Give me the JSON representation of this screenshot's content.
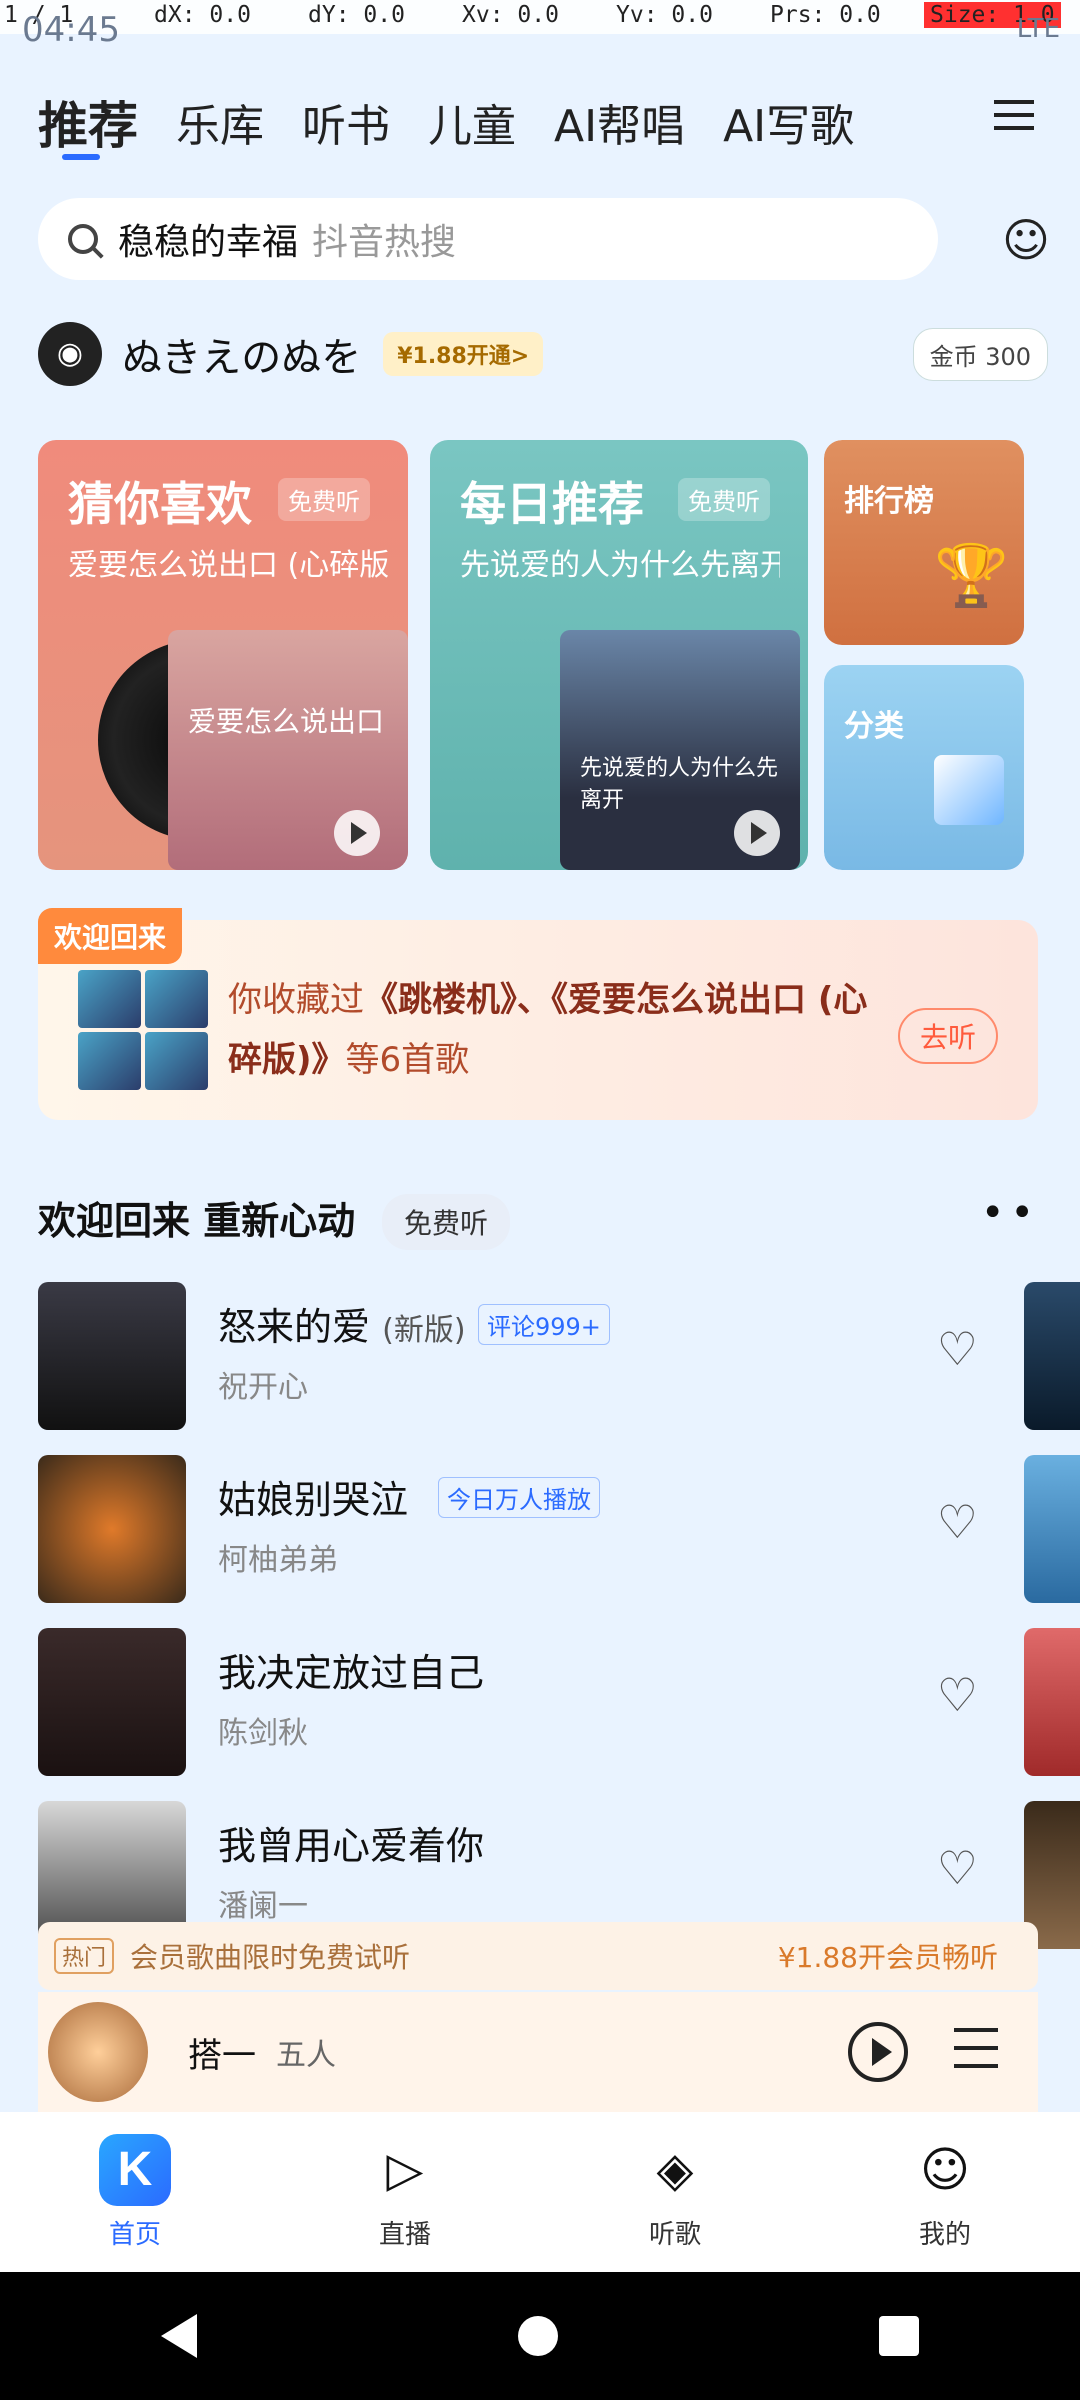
{
  "debug": {
    "pointer": "1 / 1",
    "dx": "dX: 0.0",
    "dy": "dY: 0.0",
    "xv": "Xv: 0.0",
    "yv": "Yv: 0.0",
    "prs": "Prs: 0.0",
    "size": "Size: 1.0"
  },
  "status": {
    "time": "04:45",
    "network": "LTE"
  },
  "tabs": [
    {
      "label": "推荐",
      "active": true
    },
    {
      "label": "乐库"
    },
    {
      "label": "听书"
    },
    {
      "label": "儿童"
    },
    {
      "label": "AI帮唱"
    },
    {
      "label": "AI写歌"
    }
  ],
  "search": {
    "query": "稳稳的幸福",
    "hint": "抖音热搜"
  },
  "user": {
    "name": "ぬきえのぬを",
    "vip_offer": "¥1.88开通>",
    "coins": "金币 300"
  },
  "cards": {
    "guess": {
      "title": "猜你喜欢",
      "badge": "免费听",
      "subtitle": "爱要怎么说出口 (心碎版)",
      "cover_text": "爱要怎么说出口"
    },
    "daily": {
      "title": "每日推荐",
      "badge": "免费听",
      "subtitle": "先说爱的人为什么先离开",
      "cover_text": "先说爱的人为什么先离开"
    },
    "rank": {
      "title": "排行榜"
    },
    "category": {
      "title": "分类"
    }
  },
  "comeback": {
    "tag": "欢迎回来",
    "text_prefix": "你收藏过",
    "text_bold": "《跳楼机》、《爱要怎么说出口 (心碎版)》",
    "text_suffix": "等6首歌",
    "button": "去听"
  },
  "section": {
    "title": "欢迎回来 重新心动",
    "button": "免费听",
    "more": "••"
  },
  "songs": [
    {
      "title": "怒来的爱",
      "version": "(新版)",
      "tag": "评论999+",
      "artist": "祝开心"
    },
    {
      "title": "姑娘别哭泣",
      "version": "",
      "tag": "今日万人播放",
      "artist": "柯柚弟弟"
    },
    {
      "title": "我决定放过自己",
      "version": "",
      "tag": "",
      "artist": "陈剑秋"
    },
    {
      "title": "我曾用心爱着你",
      "version": "",
      "tag": "",
      "artist": "潘阑一"
    }
  ],
  "promo": {
    "mark": "热门",
    "message": "会员歌曲限时免费试听",
    "cta": "¥1.88开会员畅听"
  },
  "player": {
    "title": "搭一",
    "artist": "五人"
  },
  "nav": [
    {
      "label": "首页",
      "icon": "home-icon",
      "active": true
    },
    {
      "label": "直播",
      "icon": "live-icon"
    },
    {
      "label": "听歌",
      "icon": "music-icon"
    },
    {
      "label": "我的",
      "icon": "profile-icon"
    }
  ],
  "colors": {
    "accent": "#2b6bff",
    "background": "#e9f3ff"
  }
}
